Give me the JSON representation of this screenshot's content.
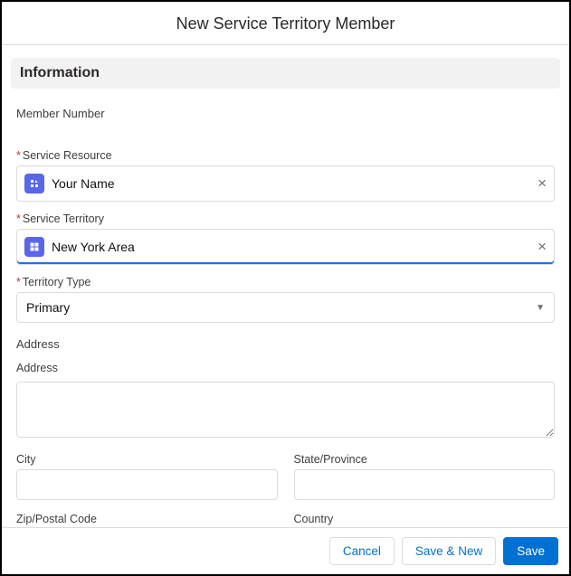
{
  "modal": {
    "title": "New Service Territory Member"
  },
  "section": {
    "title": "Information"
  },
  "fields": {
    "memberNumber": {
      "label": "Member Number"
    },
    "serviceResource": {
      "label": "Service Resource",
      "value": "Your Name"
    },
    "serviceTerritory": {
      "label": "Service Territory",
      "value": "New York Area"
    },
    "territoryType": {
      "label": "Territory Type",
      "value": "Primary"
    },
    "addressHeading": "Address",
    "address": {
      "label": "Address",
      "value": ""
    },
    "city": {
      "label": "City",
      "value": ""
    },
    "state": {
      "label": "State/Province",
      "value": ""
    },
    "zip": {
      "label": "Zip/Postal Code"
    },
    "country": {
      "label": "Country"
    }
  },
  "footer": {
    "cancel": "Cancel",
    "saveNew": "Save & New",
    "save": "Save"
  }
}
